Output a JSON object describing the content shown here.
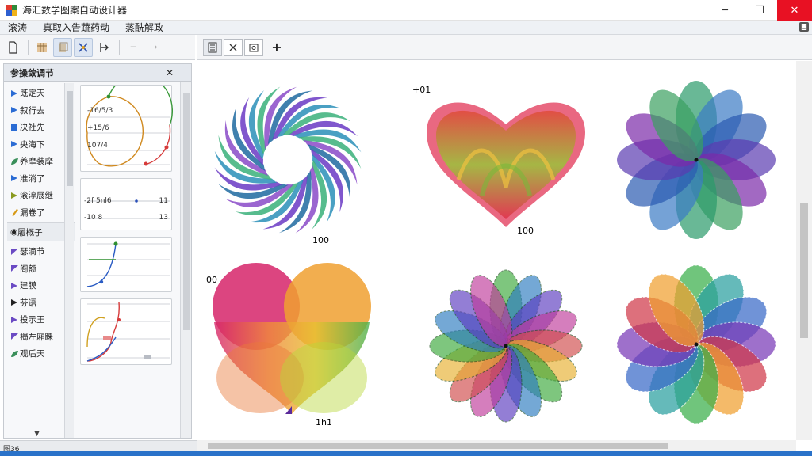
{
  "window": {
    "title": "海汇数学图案自动设计器",
    "minimize": "─",
    "maximize": "❐",
    "close": "✕"
  },
  "menu": {
    "items": [
      "滚涛",
      "真取入告蔬药动",
      "蒸酰解政"
    ],
    "corner": "◙"
  },
  "toolbar": {
    "disabled_arrow_left": "─",
    "disabled_arrow_right": "→"
  },
  "doctabs": {
    "add": "+"
  },
  "panel": {
    "title": "参操敛调节",
    "close": "✕",
    "tree_top": [
      {
        "label": "既定天",
        "icon": "play-triangle-icon",
        "color": "#2b6cd4"
      },
      {
        "label": "叙行去",
        "icon": "play-triangle-icon",
        "color": "#2b6cd4"
      },
      {
        "label": "决社先",
        "icon": "square-icon",
        "color": "#2b6cd4"
      },
      {
        "label": "央海下",
        "icon": "play-triangle-icon",
        "color": "#2b6cd4"
      },
      {
        "label": "养摩装摩",
        "icon": "leaf-icon",
        "color": "#3a8f5a"
      },
      {
        "label": "准淌了",
        "icon": "play-triangle-icon",
        "color": "#2b6cd4"
      },
      {
        "label": "滚淳展继",
        "icon": "play-triangle-icon",
        "color": "#8a9a20"
      },
      {
        "label": "漏卷了",
        "icon": "pencil-icon",
        "color": "#d79a16"
      }
    ],
    "tree_group": "履概子",
    "tree_bottom": [
      {
        "label": "瑟滴节",
        "icon": "flag-icon",
        "color": "#6b4bc4"
      },
      {
        "label": "阁额",
        "icon": "flag-icon",
        "color": "#6b4bc4"
      },
      {
        "label": "建膜",
        "icon": "play-triangle-icon",
        "color": "#6b4bc4"
      },
      {
        "label": "芬语",
        "icon": "play-triangle-icon",
        "color": "#222222"
      },
      {
        "label": "投示王",
        "icon": "play-triangle-icon",
        "color": "#6b4bc4"
      },
      {
        "label": "揭左厢睐",
        "icon": "flag-icon",
        "color": "#6b4bc4"
      },
      {
        "label": "观后天",
        "icon": "leaf-icon",
        "color": "#3a8f5a"
      }
    ],
    "param_card1": {
      "v1": "-16/5/3",
      "v2": "+15/6",
      "v3": "107/4"
    },
    "param_card2": {
      "v1": "-2f 5nl6",
      "v1_end": "11",
      "v2": "-10 8",
      "v2_end": "13"
    },
    "status": "图36"
  },
  "canvas": {
    "labels": {
      "spiral": "100",
      "heart_corner": "+01",
      "heart": "100",
      "heart2_corner": "00",
      "heart2": "1h1"
    }
  }
}
